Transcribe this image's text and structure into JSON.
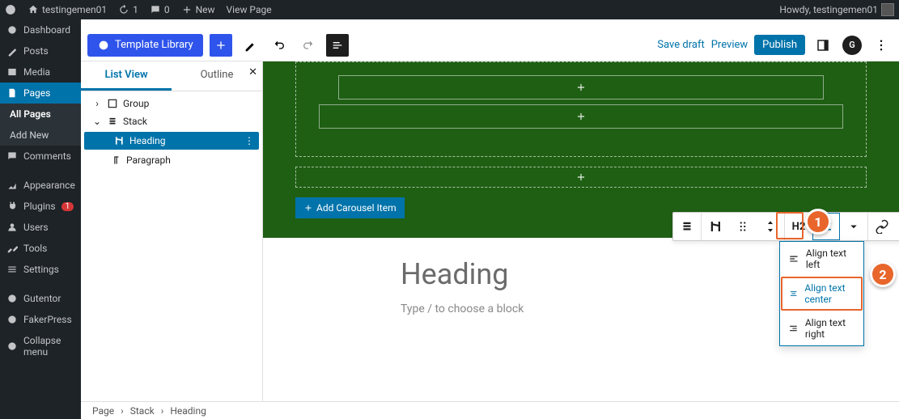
{
  "adminbar": {
    "site": "testingemen01",
    "refresh": "1",
    "comments": "0",
    "new": "New",
    "view": "View Page",
    "howdy": "Howdy, testingemen01"
  },
  "sidemenu": {
    "items": [
      {
        "label": "Dashboard"
      },
      {
        "label": "Posts"
      },
      {
        "label": "Media"
      },
      {
        "label": "Pages"
      },
      {
        "label": "Comments"
      },
      {
        "label": "Appearance"
      },
      {
        "label": "Plugins"
      },
      {
        "label": "Users"
      },
      {
        "label": "Tools"
      },
      {
        "label": "Settings"
      },
      {
        "label": "Gutentor"
      },
      {
        "label": "FakerPress"
      },
      {
        "label": "Collapse menu"
      }
    ],
    "plugins_badge": "1",
    "sub_all": "All Pages",
    "sub_add": "Add New"
  },
  "topbar": {
    "library": "Template Library",
    "save_draft": "Save draft",
    "preview": "Preview",
    "publish": "Publish"
  },
  "listpanel": {
    "tab_list": "List View",
    "tab_outline": "Outline",
    "tree": {
      "group": "Group",
      "stack": "Stack",
      "heading": "Heading",
      "paragraph": "Paragraph"
    }
  },
  "canvas": {
    "add_carousel": "Add Carousel Item",
    "heading": "Heading",
    "placeholder": "Type / to choose a block",
    "h2": "H2"
  },
  "align": {
    "left": "Align text left",
    "center": "Align text center",
    "right": "Align text right"
  },
  "breadcrumb": {
    "a": "Page",
    "b": "Stack",
    "c": "Heading"
  },
  "callouts": {
    "one": "1",
    "two": "2"
  }
}
